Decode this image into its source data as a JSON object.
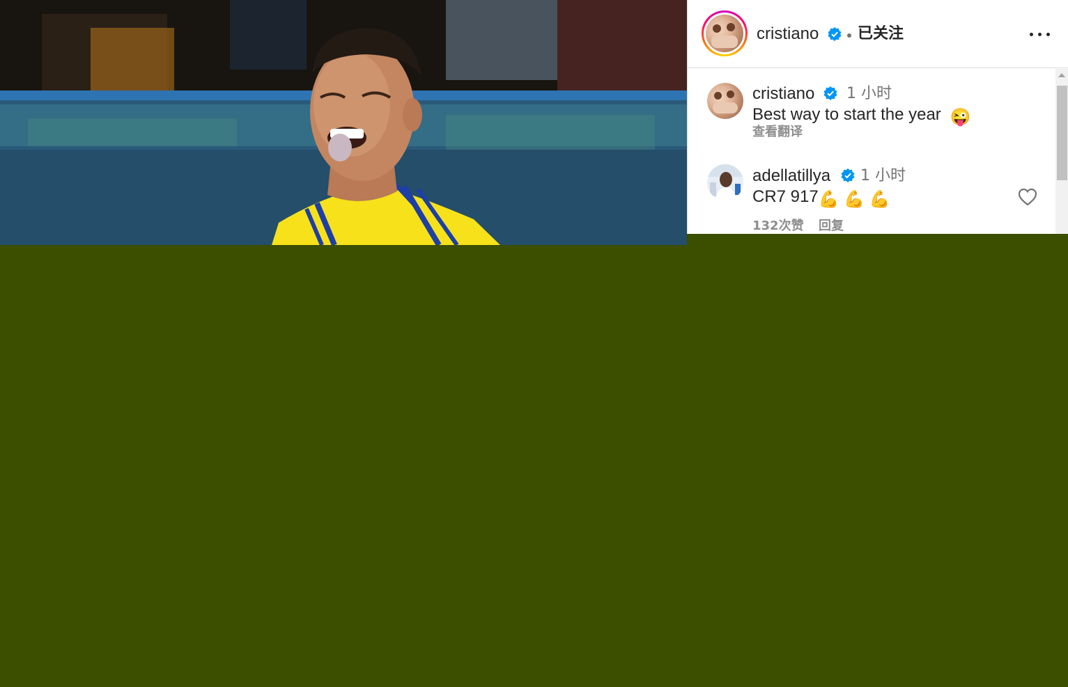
{
  "post": {
    "author": "cristiano",
    "verified": true,
    "follow_status": "已关注",
    "more_icon": "more-horizontal-icon"
  },
  "comments": [
    {
      "user": "cristiano",
      "verified": true,
      "time": "1 小时",
      "text": "Best way to start the year",
      "emoji": "😜",
      "translate": "查看翻译"
    },
    {
      "user": "adellatillya",
      "verified": true,
      "time": "1 小时",
      "text": "CR7 917",
      "emoji": "💪 💪 💪",
      "likes": "132次赞",
      "reply": "回复"
    }
  ],
  "colors": {
    "verified_blue": "#0095f6",
    "background_fill": "#3c4e00",
    "jersey_yellow": "#f7e11a",
    "jersey_blue": "#1d3fa8"
  }
}
